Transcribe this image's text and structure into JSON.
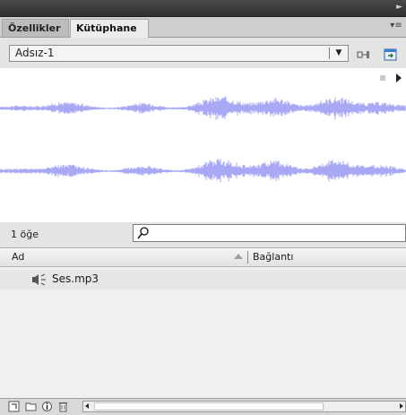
{
  "panel": {
    "tabs": [
      {
        "label": "Özellikler",
        "active": false
      },
      {
        "label": "Kütüphane",
        "active": true
      }
    ]
  },
  "document_selector": {
    "value": "Adsız-1"
  },
  "preview": {
    "waveform_color": "#a8a8f4"
  },
  "library": {
    "count_text": "1 öğe",
    "search": {
      "value": "",
      "placeholder": ""
    },
    "columns": [
      {
        "label": "Ad"
      },
      {
        "label": "Bağlantı"
      }
    ],
    "items": [
      {
        "name": "Ses.mp3",
        "icon": "speaker-icon"
      }
    ]
  },
  "colors": {
    "panel_bg": "#d6d6d6",
    "tab_active": "#ececec",
    "waveform": "#a8a8f4"
  }
}
